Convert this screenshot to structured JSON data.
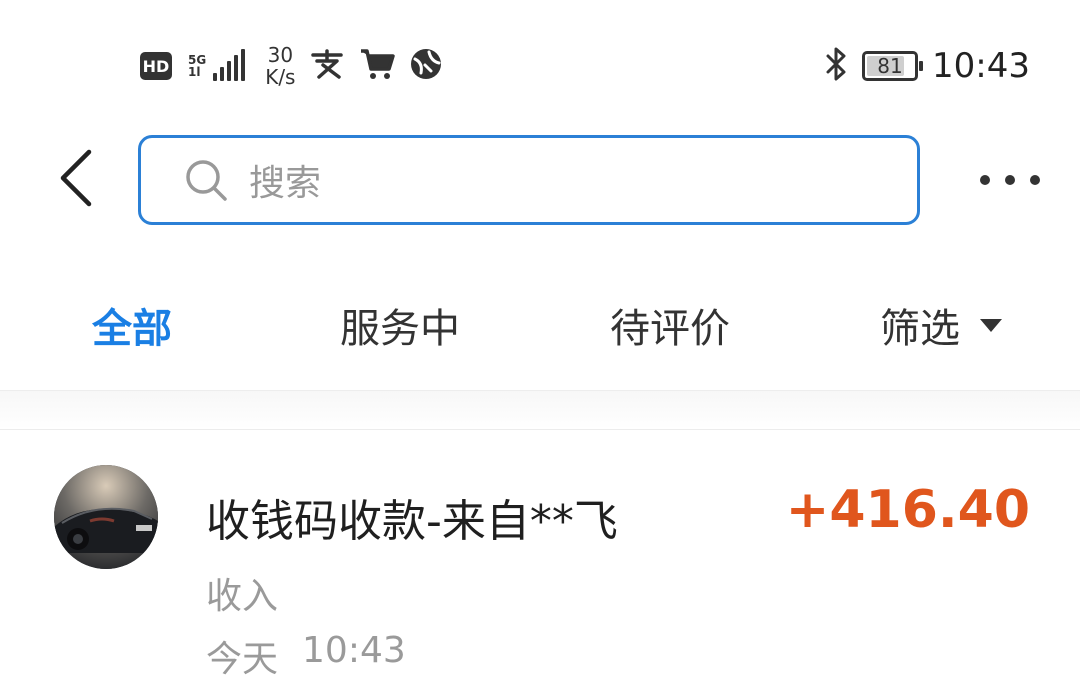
{
  "status_bar": {
    "hd_label": "HD",
    "network_label": "5G",
    "network_sub": "1l",
    "speed_value": "30",
    "speed_unit": "K/s",
    "app_icons": [
      "alipay-icon",
      "cart-icon",
      "globe-icon"
    ],
    "bluetooth_icon": "bluetooth-icon",
    "battery_level": 81,
    "battery_label": "81",
    "time": "10:43"
  },
  "header": {
    "back_icon": "chevron-left-icon",
    "search_placeholder": "搜索",
    "more_icon": "more-dots-icon",
    "accent_color": "#2b80d6"
  },
  "tabs": [
    {
      "label": "全部",
      "active": true
    },
    {
      "label": "服务中",
      "active": false
    },
    {
      "label": "待评价",
      "active": false
    },
    {
      "label": "筛选",
      "active": false,
      "icon": "caret-down-icon"
    }
  ],
  "tab_active_color": "#1a7fe4",
  "transactions": [
    {
      "title": "收钱码收款-来自**飞",
      "amount": "+416.40",
      "amount_color": "#e0561d",
      "type": "收入",
      "date": "今天",
      "time": "10:43"
    }
  ]
}
